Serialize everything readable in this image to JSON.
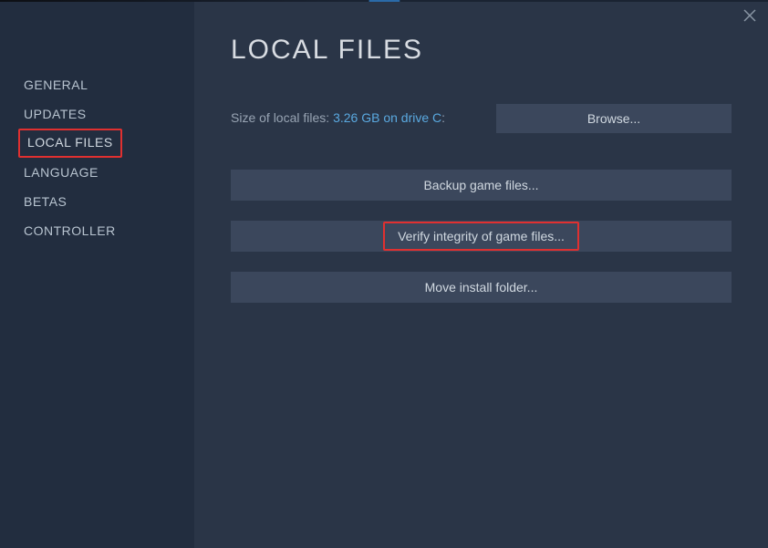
{
  "sidebar": {
    "items": [
      {
        "label": "GENERAL"
      },
      {
        "label": "UPDATES"
      },
      {
        "label": "LOCAL FILES"
      },
      {
        "label": "LANGUAGE"
      },
      {
        "label": "BETAS"
      },
      {
        "label": "CONTROLLER"
      }
    ]
  },
  "page": {
    "title": "LOCAL FILES"
  },
  "localFiles": {
    "sizeLabel": "Size of local files: ",
    "sizeValue": "3.26 GB on drive C",
    "sizeSuffix": ":",
    "browseLabel": "Browse...",
    "backupLabel": "Backup game files...",
    "verifyLabel": "Verify integrity of game files...",
    "moveLabel": "Move install folder..."
  }
}
